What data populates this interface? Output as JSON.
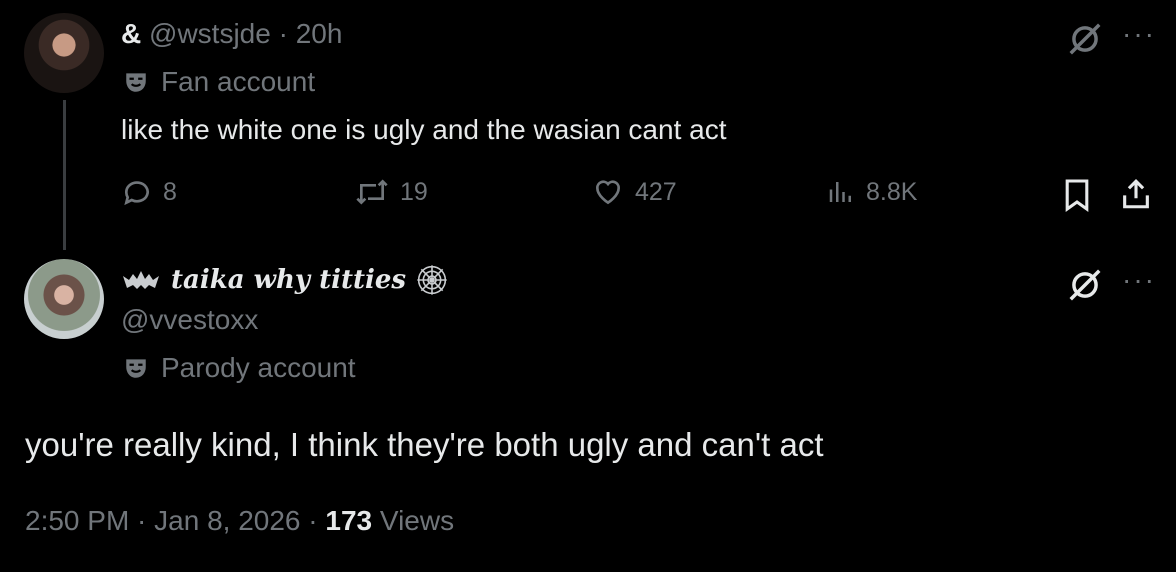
{
  "tweet": {
    "display_name": "&",
    "handle": "@wstsjde",
    "separator": "·",
    "time": "20h",
    "label": "Fan account",
    "text": "like the white one is ugly and the wasian cant act",
    "replies": "8",
    "reposts": "19",
    "likes": "427",
    "views": "8.8K"
  },
  "reply": {
    "display_name": "taika why titties",
    "handle": "@vvestoxx",
    "label": "Parody account",
    "text": "you're really kind, I think they're both ugly and can't act",
    "timestamp": "2:50 PM · Jan 8, 2026",
    "separator": "·",
    "views_count": "173",
    "views_label": "Views"
  },
  "icons": {
    "reply": "reply-icon",
    "repost": "repost-icon",
    "like": "heart-icon",
    "views": "analytics-icon",
    "bookmark": "bookmark-icon",
    "share": "share-icon",
    "grok": "grok-icon",
    "more": "more-icon",
    "label_badge": "mask-icon",
    "bat": "bat-icon",
    "web": "spiderweb-icon"
  },
  "colors": {
    "background": "#000000",
    "text": "#e7e9ea",
    "muted": "#71767b"
  }
}
